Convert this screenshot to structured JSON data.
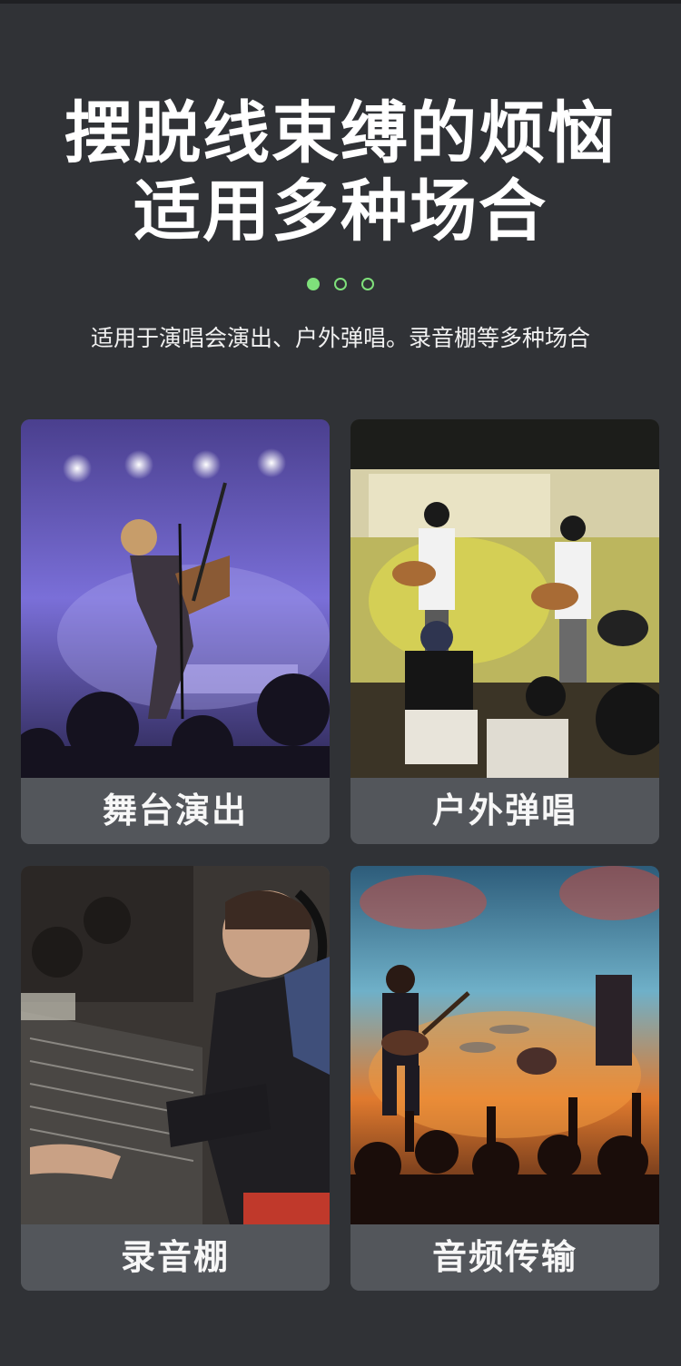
{
  "headline": {
    "line1": "摆脱线束缚的烦恼",
    "line2": "适用多种场合"
  },
  "carousel": {
    "total": 3,
    "active_index": 0,
    "active_color": "#7fe07b"
  },
  "subtitle": "适用于演唱会演出、户外弹唱。录音棚等多种场合",
  "cards": [
    {
      "caption": "舞台演出"
    },
    {
      "caption": "户外弹唱"
    },
    {
      "caption": "录音棚"
    },
    {
      "caption": "音频传输"
    }
  ],
  "colors": {
    "background": "#303236",
    "caption_bg": "#53565b"
  }
}
